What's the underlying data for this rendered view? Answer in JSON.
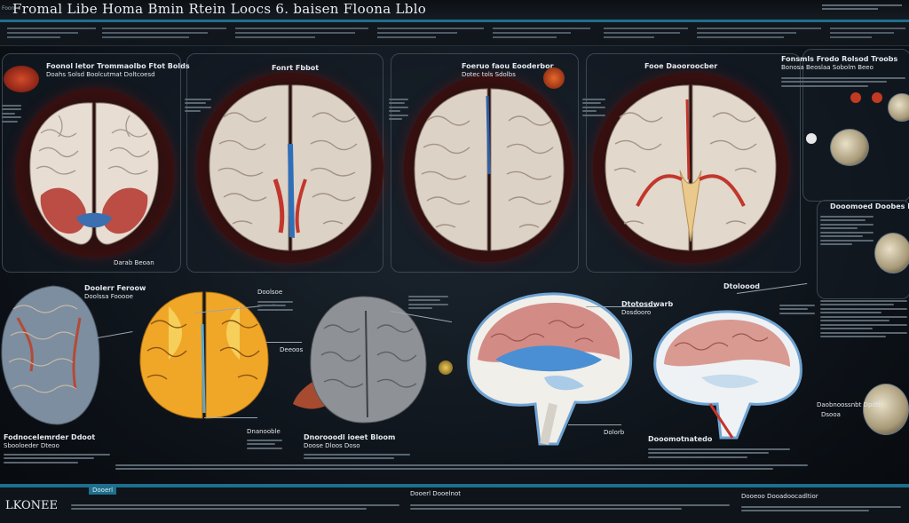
{
  "header": {
    "title": "Fromal Libe Homa Bmin Rtein Loocs 6. baisen Floona Lblo",
    "small_tag": "Foonl"
  },
  "labels": {
    "top_left": "Foonol letor Trommaolbo Ftot Bolds",
    "top_left_2": "Doahs Solsd Boolcutmat Doltcoesd",
    "top_left_bottom": "Darab Beoan",
    "top_center_left": "Fonrt Fbbot",
    "top_center": "Foeruo faou Eooderbor",
    "top_center_2": "Dotec tols Sdolbs",
    "top_right": "Fooe Daooroocber",
    "right_panel_title": "Fonsmls Frodo Rolsod Troobs",
    "right_panel_2": "Bonosa Beoslaa Sobolm Beeo",
    "right_mid": "Dooomoed Doobes Doonbrs",
    "bottom_left": "Fodnocelemrder Ddoot",
    "bottom_left_2": "Sbooloeder Dteoo",
    "bottom_center_left": "Dnanooble",
    "bottom_center": "Dnorooodl ioeet Bloom",
    "bottom_center_2": "Doose Dloos Doso",
    "bottom_mid": "Dolorb",
    "bottom_right": "Dooomotnatedo",
    "mid_label_1": "Doolerr Feroow",
    "mid_label_2": "Doolssa Fooooe",
    "mid_label_3": "Doolsoe",
    "mid_label_4": "Deeoos",
    "mid_right_1": "Dtotosdwarb",
    "mid_right_2": "Dosdooro",
    "mid_right_3": "Dtoloood",
    "far_right_1": "Daobnoossnbt Dpdtl",
    "far_right_2": "Dsooa"
  },
  "footer": {
    "logo": "LKONEE",
    "tab_label": "Dooerl",
    "center_label": "Dooerl Dooelnot",
    "right_label": "Dooeoo Dooadoocadltior"
  }
}
